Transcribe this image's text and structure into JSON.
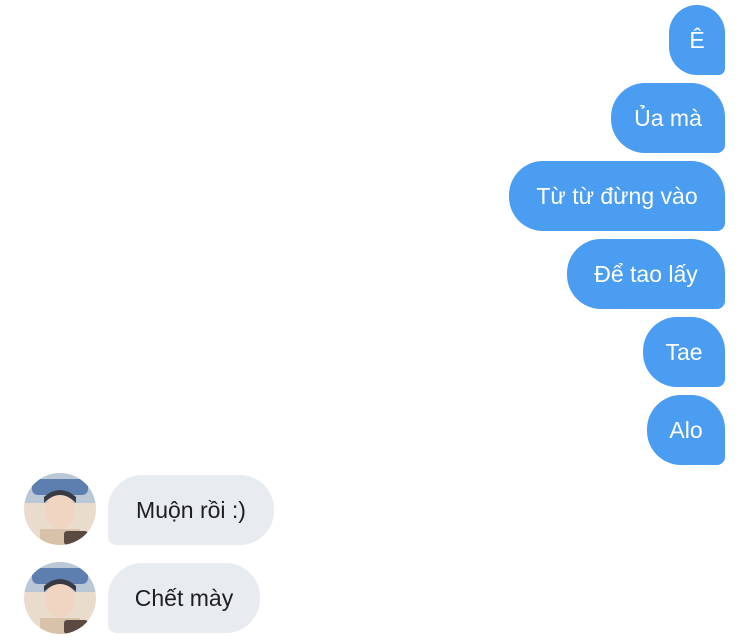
{
  "messages": {
    "outgoing": [
      {
        "text": "Ê"
      },
      {
        "text": "Ủa mà"
      },
      {
        "text": "Từ từ đừng vào"
      },
      {
        "text": "Để tao lấy"
      },
      {
        "text": "Tae"
      },
      {
        "text": "Alo"
      }
    ],
    "incoming": [
      {
        "text": "Muộn rồi :)",
        "avatar_icon": "contact-avatar"
      },
      {
        "text": "Chết mày",
        "avatar_icon": "contact-avatar"
      }
    ]
  },
  "colors": {
    "outgoing_bubble": "#4a9df0",
    "incoming_bubble": "#e8ecf0",
    "outgoing_text": "#ffffff",
    "incoming_text": "#1c1e21"
  }
}
